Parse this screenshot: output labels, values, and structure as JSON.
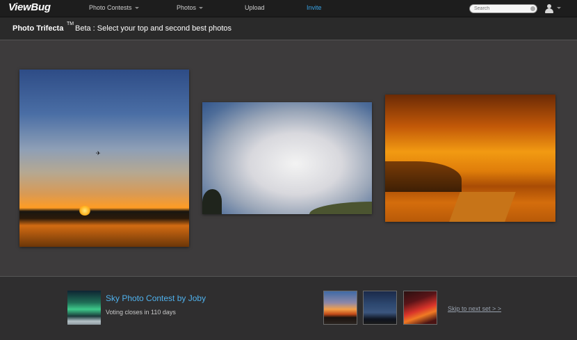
{
  "nav": {
    "logo": "ViewBug",
    "items": [
      {
        "label": "Photo Contests"
      },
      {
        "label": "Photos"
      },
      {
        "label": "Upload"
      },
      {
        "label": "Invite"
      }
    ],
    "search_placeholder": "Search"
  },
  "header": {
    "title": "Photo Trifecta",
    "tm": "TM",
    "subtitle": "Beta : Select your top and second best photos"
  },
  "photos": [
    {
      "name": "sunset-lake"
    },
    {
      "name": "cumulus-clouds"
    },
    {
      "name": "golden-dunes"
    }
  ],
  "footer": {
    "contest_title": "Sky Photo Contest by Joby",
    "voting_text": "Voting closes in 110 days",
    "skip_label": "Skip to next set > >"
  },
  "colors": {
    "accent": "#37a3e6",
    "link_blue": "#4fb2ee",
    "background": "#3d3b3c"
  }
}
